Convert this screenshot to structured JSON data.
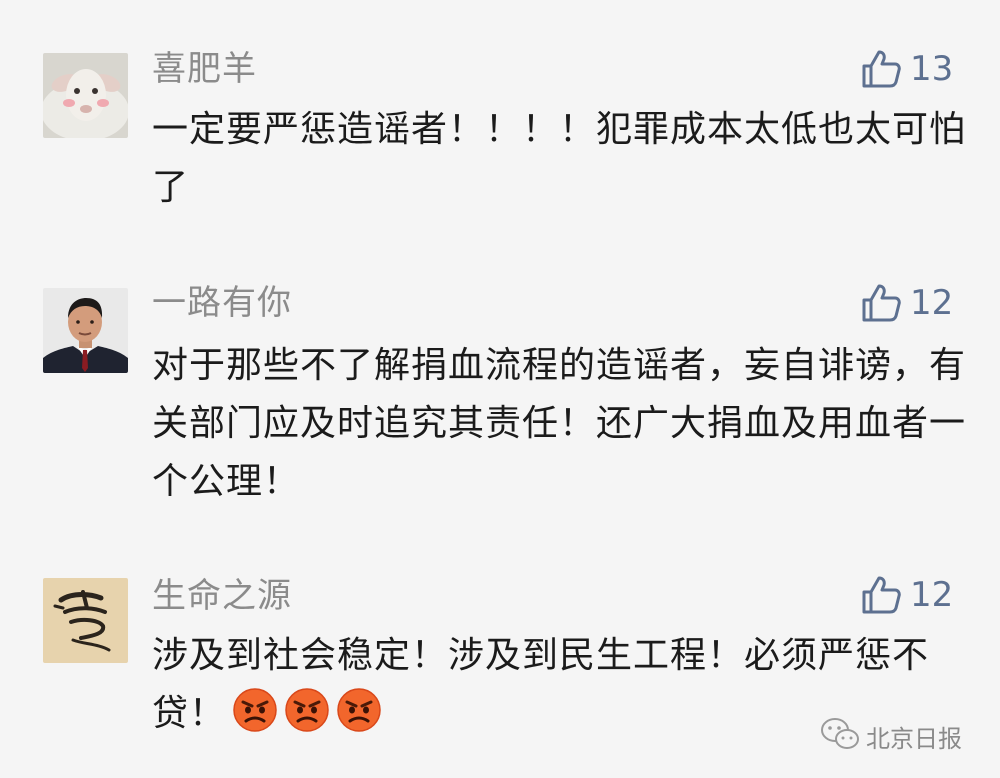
{
  "comments": [
    {
      "username": "喜肥羊",
      "likes": "13",
      "avatar": "sheep-avatar",
      "text": "一定要严惩造谣者！！！！犯罪成本太低也太可怕了"
    },
    {
      "username": "一路有你",
      "likes": "12",
      "avatar": "man-in-suit-avatar",
      "text": "对于那些不了解捐血流程的造谣者，妄自诽谤，有关部门应及时追究其责任！还广大捐血及用血者一个公理！"
    },
    {
      "username": "生命之源",
      "likes": "12",
      "avatar": "calligraphy-avatar",
      "text": "涉及到社会稳定！涉及到民生工程！必须严惩不贷！",
      "emojis": [
        "angry-face-emoji",
        "angry-face-emoji",
        "angry-face-emoji"
      ]
    }
  ],
  "icons": {
    "like": "thumbs-up-icon",
    "watermark": "wechat-icon"
  },
  "watermark": {
    "text": "北京日报"
  },
  "colors": {
    "background": "#f5f5f5",
    "username": "#8b8b8b",
    "like": "#5d7090",
    "text": "#1b1b1b"
  }
}
